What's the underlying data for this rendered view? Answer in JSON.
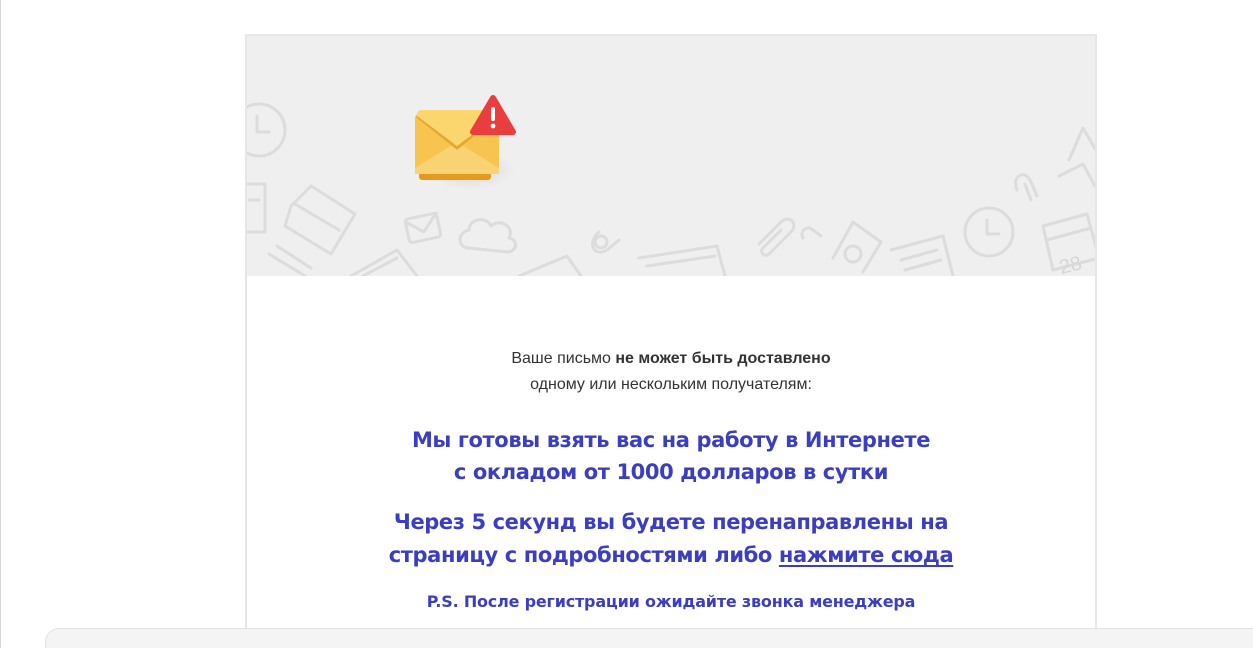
{
  "notice": {
    "prefix": "Ваше письмо ",
    "bold": "не может быть доставлено",
    "line2": "одному или нескольким получателям:"
  },
  "promo": {
    "line1": "Мы готовы взять вас на работу в Интернете",
    "line2": "с окладом от 1000 долларов в сутки",
    "line3": "Через 5 секунд вы будете перенаправлены на",
    "line4_prefix": "страницу с подробностями либо ",
    "link": "нажмите сюда",
    "ps": "P.S. После регистрации ожидайте звонка менеджера"
  },
  "banner": {
    "calendar_number": "28"
  },
  "icons": [
    "envelope-warning-icon",
    "warning-badge-icon",
    "clock-icon",
    "folder-icon",
    "mail-icon",
    "cloud-icon",
    "paperclip-icon",
    "calendar-icon",
    "pencil-icon",
    "bell-icon",
    "pointer-icon"
  ],
  "colors": {
    "promo_text": "#3b3ec0",
    "banner_bg": "#efefef",
    "envelope": "#f5c14a",
    "warning": "#ea3d3d"
  }
}
